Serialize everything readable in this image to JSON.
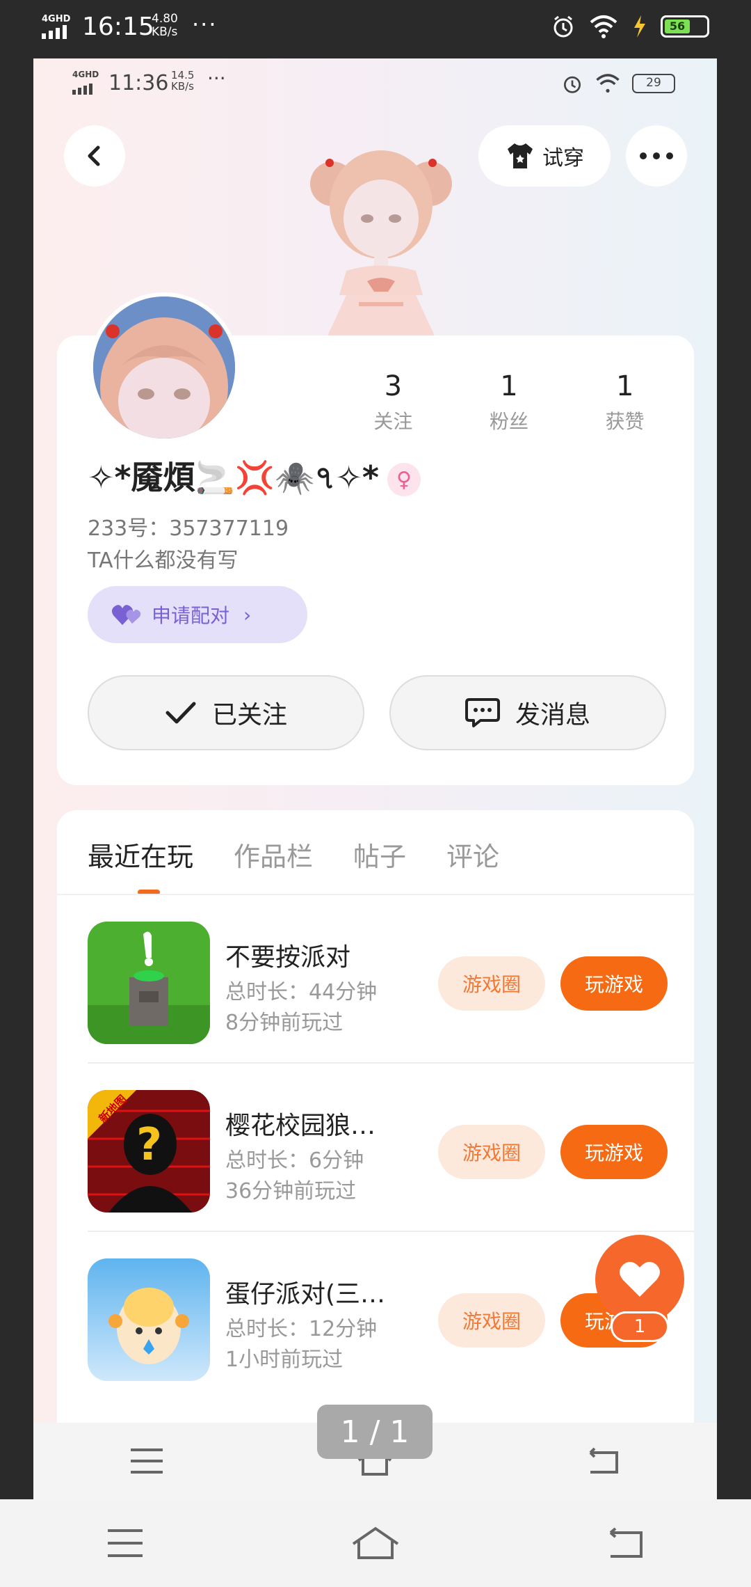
{
  "outer_status": {
    "network": "4GHD",
    "time": "16:15",
    "speed_value": "4.80",
    "speed_unit": "KB/s",
    "more": "···",
    "battery": "56"
  },
  "inner_status": {
    "network": "4GHD",
    "time": "11:36",
    "speed_value": "14.5",
    "speed_unit": "KB/s",
    "more": "···",
    "battery": "29"
  },
  "header": {
    "try_on_label": "试穿"
  },
  "profile": {
    "stats": [
      {
        "value": "3",
        "label": "关注"
      },
      {
        "value": "1",
        "label": "粉丝"
      },
      {
        "value": "1",
        "label": "获赞"
      }
    ],
    "nickname": "✧*魇煩🚬💢🕷️৭✧*",
    "gender_symbol": "♀",
    "id_text": "233号：357377119",
    "bio": "TA什么都没有写",
    "pair_label": "申请配对",
    "follow_label": "已关注",
    "message_label": "发消息"
  },
  "tabs": [
    {
      "label": "最近在玩",
      "active": true
    },
    {
      "label": "作品栏",
      "active": false
    },
    {
      "label": "帖子",
      "active": false
    },
    {
      "label": "评论",
      "active": false
    }
  ],
  "games": [
    {
      "name": "不要按派对",
      "duration": "总时长：44分钟",
      "last_played": "8分钟前玩过",
      "circle_label": "游戏圈",
      "play_label": "玩游戏"
    },
    {
      "name": "樱花校园狼…",
      "duration": "总时长：6分钟",
      "last_played": "36分钟前玩过",
      "circle_label": "游戏圈",
      "play_label": "玩游戏",
      "badge": "新地图"
    },
    {
      "name": "蛋仔派对(三…",
      "duration": "总时长：12分钟",
      "last_played": "1小时前玩过",
      "circle_label": "游戏圈",
      "play_label": "玩游戏"
    }
  ],
  "like": {
    "count": "1"
  },
  "page_indicator": "1 / 1",
  "colors": {
    "accent": "#f56a12",
    "pair": "#7961d4"
  }
}
